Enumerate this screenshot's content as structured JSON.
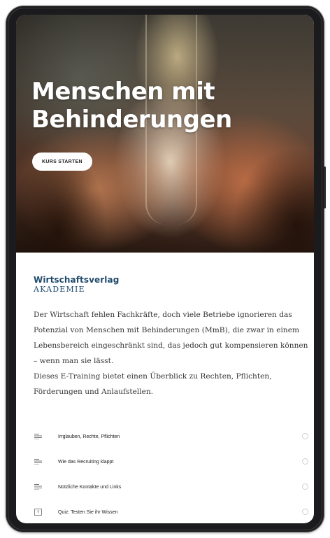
{
  "hero": {
    "title_line1": "Menschen mit",
    "title_line2": "Behinderungen",
    "start_button": "KURS STARTEN"
  },
  "brand": {
    "name": "Wirtschaftsverlag",
    "subtitle": "AKADEMIE",
    "color": "#1e4a6b"
  },
  "intro": {
    "paragraph1": "Der Wirtschaft fehlen Fachkräfte, doch viele Betriebe ignorieren das Potenzial von Menschen mit Behinderungen (MmB), die zwar in einem Lebensbereich eingeschränkt sind, das jedoch gut kompensieren können – wenn man sie lässt.",
    "paragraph2": "Dieses E-Training bietet einen Überblick zu Rechten, Pflichten, Förderungen und Anlaufstellen."
  },
  "lessons": [
    {
      "label": "Irrglauben, Rechte, Pflichten",
      "icon": "lesson-lines-icon",
      "completed": false
    },
    {
      "label": "Wie das Recruiting klappt",
      "icon": "lesson-lines-icon",
      "completed": false
    },
    {
      "label": "Nützliche Kontakte und Links",
      "icon": "lesson-lines-icon",
      "completed": false
    },
    {
      "label": "Quiz: Testen Sie ihr Wissen",
      "icon": "quiz-icon",
      "completed": false
    }
  ]
}
